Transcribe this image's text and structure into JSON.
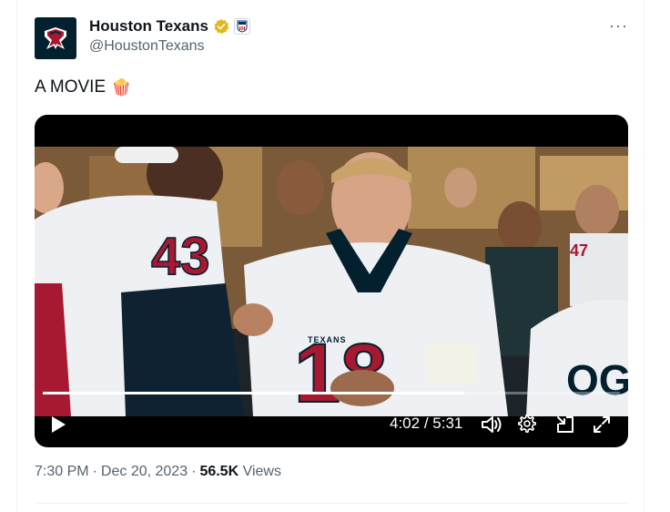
{
  "author": {
    "name": "Houston Texans",
    "handle": "@HoustonTexans",
    "verified": true,
    "affiliate_badge": "NFL"
  },
  "more_label": "···",
  "post": {
    "text": "A MOVIE",
    "emoji": "🍿"
  },
  "video": {
    "current_time": "4:02",
    "separator": "/",
    "duration": "5:31",
    "progress_fraction": 0.73,
    "jersey_numbers": [
      "43",
      "18",
      "47"
    ],
    "jersey_text": "OGU",
    "jersey_wordmark": "TEXANS",
    "controls": [
      "play-icon",
      "volume-icon",
      "settings-icon",
      "picture-in-picture-icon",
      "fullscreen-icon"
    ]
  },
  "meta": {
    "time": "7:30 PM",
    "dot1": "·",
    "date": "Dec 20, 2023",
    "dot2": "·",
    "views_count": "56.5K",
    "views_label": "Views"
  },
  "colors": {
    "text": "#0f1419",
    "secondary": "#536471",
    "verified_gold": "#e2b719",
    "texans_red": "#a71930",
    "texans_navy": "#03202f"
  }
}
